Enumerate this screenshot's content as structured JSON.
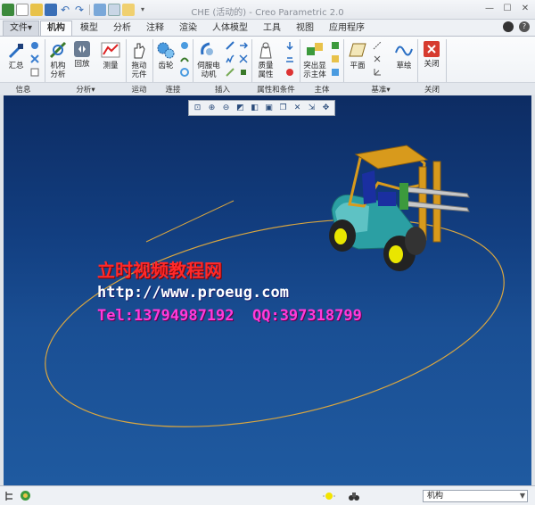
{
  "window": {
    "title": "CHE (活动的) - Creo Parametric 2.0"
  },
  "tabs": [
    {
      "label": "文件▾"
    },
    {
      "label": "机构"
    },
    {
      "label": "模型"
    },
    {
      "label": "分析"
    },
    {
      "label": "注释"
    },
    {
      "label": "渲染"
    },
    {
      "label": "人体模型"
    },
    {
      "label": "工具"
    },
    {
      "label": "视图"
    },
    {
      "label": "应用程序"
    }
  ],
  "ribbon": {
    "buttons": {
      "summary": "汇总",
      "mech_analysis_1": "机构",
      "mech_analysis_2": "分析",
      "playback": "回放",
      "measure": "测量",
      "drag_1": "拖动",
      "drag_2": "元件",
      "gear": "齿轮",
      "servo_1": "伺服电",
      "servo_2": "动机",
      "mass_1": "质量",
      "mass_2": "属性",
      "highlight_1": "突出显",
      "highlight_2": "示主体",
      "plane": "平面",
      "sketch": "草绘",
      "close": "关闭"
    },
    "groups": {
      "info": "信息",
      "analysis": "分析▾",
      "motion": "运动",
      "connect": "连接",
      "insert": "插入",
      "props": "属性和条件",
      "body": "主体",
      "datum": "基准▾",
      "close": "关闭"
    }
  },
  "watermark": {
    "line1": "立时视频教程网",
    "line2": "http://www.proeug.com",
    "line3": "Tel:13794987192  QQ:397318799"
  },
  "statusbar": {
    "filter_value": "机构"
  },
  "colors": {
    "viewport_top": "#0d2c63",
    "viewport_bottom": "#1f5aa0",
    "trajectory": "#d9a640",
    "forklift_body": "#2b9fa3",
    "forklift_frame": "#d89a1c",
    "wheel_rim": "#e9e600"
  }
}
